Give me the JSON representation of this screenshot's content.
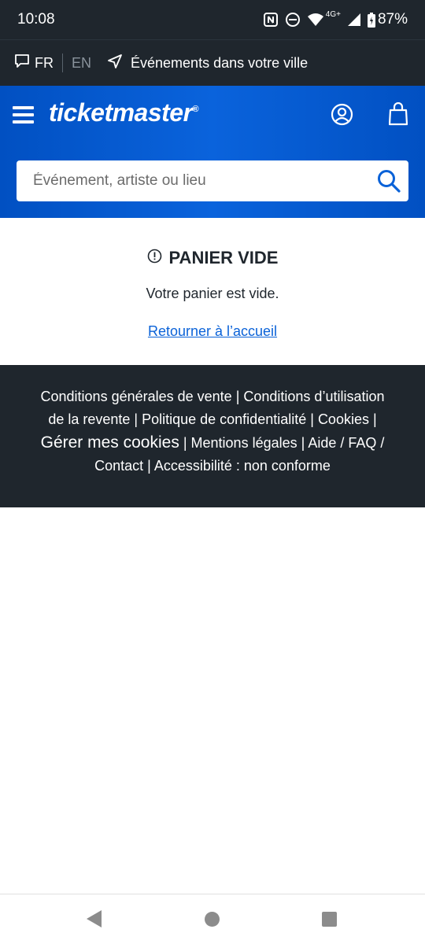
{
  "status_bar": {
    "time": "10:08",
    "network": "4G+",
    "battery": "87%"
  },
  "lang_bar": {
    "lang_active": "FR",
    "lang_other": "EN",
    "location_text": "Événements dans votre ville"
  },
  "header": {
    "logo": "ticketmaster",
    "logo_mark": "®",
    "search_placeholder": "Événement, artiste ou lieu"
  },
  "content": {
    "title": "PANIER VIDE",
    "message": "Votre panier est vide.",
    "home_link": "Retourner à l’accueil"
  },
  "footer": {
    "links": {
      "cgv": "Conditions générales de vente",
      "cgu_resale": "Conditions d’utilisation de la revente",
      "privacy": "Politique de confidentialité",
      "cookies": "Cookies",
      "manage_cookies": "Gérer mes cookies",
      "legal": "Mentions légales",
      "help": "Aide / FAQ",
      "contact": "Contact",
      "accessibility": "Accessibilité : non conforme"
    }
  },
  "colors": {
    "brand_blue": "#0150c2",
    "dark": "#1f262d",
    "link": "#0a62d8"
  },
  "icons": [
    "chat-icon",
    "location-arrow-icon",
    "menu-icon",
    "account-icon",
    "bag-icon",
    "search-icon",
    "alert-icon",
    "back-icon",
    "home-icon",
    "recents-icon"
  ]
}
